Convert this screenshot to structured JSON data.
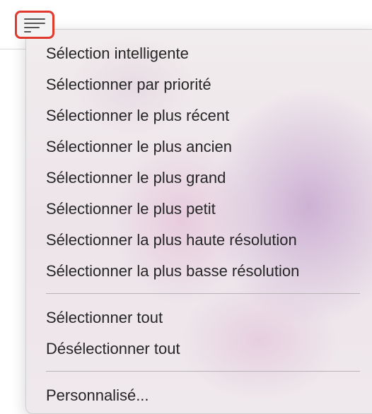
{
  "menu": {
    "items_group1": [
      {
        "label": "Sélection intelligente"
      },
      {
        "label": "Sélectionner par priorité"
      },
      {
        "label": "Sélectionner le plus récent"
      },
      {
        "label": "Sélectionner le plus ancien"
      },
      {
        "label": "Sélectionner le plus grand"
      },
      {
        "label": "Sélectionner le plus petit"
      },
      {
        "label": "Sélectionner la plus haute résolution"
      },
      {
        "label": "Sélectionner la plus basse résolution"
      }
    ],
    "items_group2": [
      {
        "label": "Sélectionner tout"
      },
      {
        "label": "Désélectionner tout"
      }
    ],
    "items_group3": [
      {
        "label": "Personnalisé..."
      }
    ]
  },
  "trigger": {
    "icon": "list-filter-icon",
    "highlight_color": "#e03a2f"
  }
}
